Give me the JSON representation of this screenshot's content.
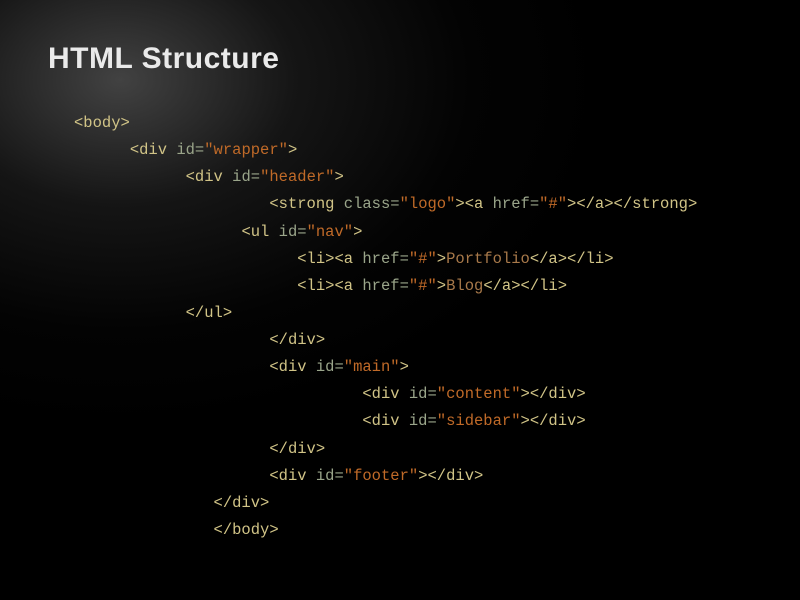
{
  "title": "HTML Structure",
  "code": {
    "l1": "<body>",
    "l2a": "<div",
    "l2b": " id=",
    "l2c": "\"wrapper\"",
    "l2d": ">",
    "l3a": "<div",
    "l3b": " id=",
    "l3c": "\"header\"",
    "l3d": ">",
    "l4a": "<strong",
    "l4b": " class=",
    "l4c": "\"logo\"",
    "l4d": "><a",
    "l4e": " href=",
    "l4f": "\"#\"",
    "l4g": "></a></strong>",
    "l5a": "<ul",
    "l5b": " id=",
    "l5c": "\"nav\"",
    "l5d": ">",
    "l6a": "<li><a",
    "l6b": " href=",
    "l6c": "\"#\"",
    "l6d": ">",
    "l6e": "Portfolio",
    "l6f": "</a></li>",
    "l7a": "<li><a",
    "l7b": " href=",
    "l7c": "\"#\"",
    "l7d": ">",
    "l7e": "Blog",
    "l7f": "</a></li>",
    "l8": "</ul>",
    "l9": "</div>",
    "l10a": "<div",
    "l10b": " id=",
    "l10c": "\"main\"",
    "l10d": ">",
    "l11a": "<div",
    "l11b": " id=",
    "l11c": "\"content\"",
    "l11d": "></div>",
    "l12a": "<div",
    "l12b": " id=",
    "l12c": "\"sidebar\"",
    "l12d": "></div>",
    "l13": "</div>",
    "l14a": "<div",
    "l14b": " id=",
    "l14c": "\"footer\"",
    "l14d": "></div>",
    "l15": "</div>",
    "l16": "</body>"
  }
}
